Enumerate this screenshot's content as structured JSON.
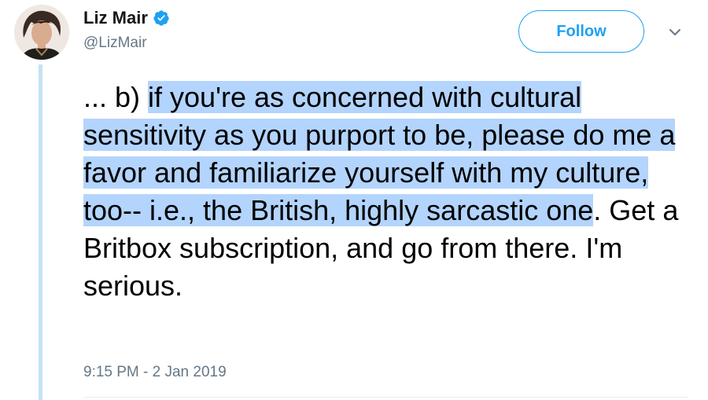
{
  "author": {
    "name": "Liz Mair",
    "handle": "@LizMair",
    "verified": true
  },
  "follow_button": {
    "label": "Follow"
  },
  "tweet": {
    "text_before": "... b) ",
    "text_highlighted": "if you're as concerned with cultural sensitivity as you purport to be, please do me a favor and familiarize yourself with my culture, too-- i.e., the British, highly sarcastic one",
    "text_after": ". Get a Britbox subscription, and go from there. I'm serious."
  },
  "timestamp": "9:15 PM - 2 Jan 2019",
  "icons": {
    "verified": "verified-badge-icon",
    "more": "chevron-down-icon"
  },
  "colors": {
    "brand": "#1da1f2",
    "highlight": "#b3d4fc",
    "secondary_text": "#657786",
    "thread_line": "#c4e2f7"
  }
}
